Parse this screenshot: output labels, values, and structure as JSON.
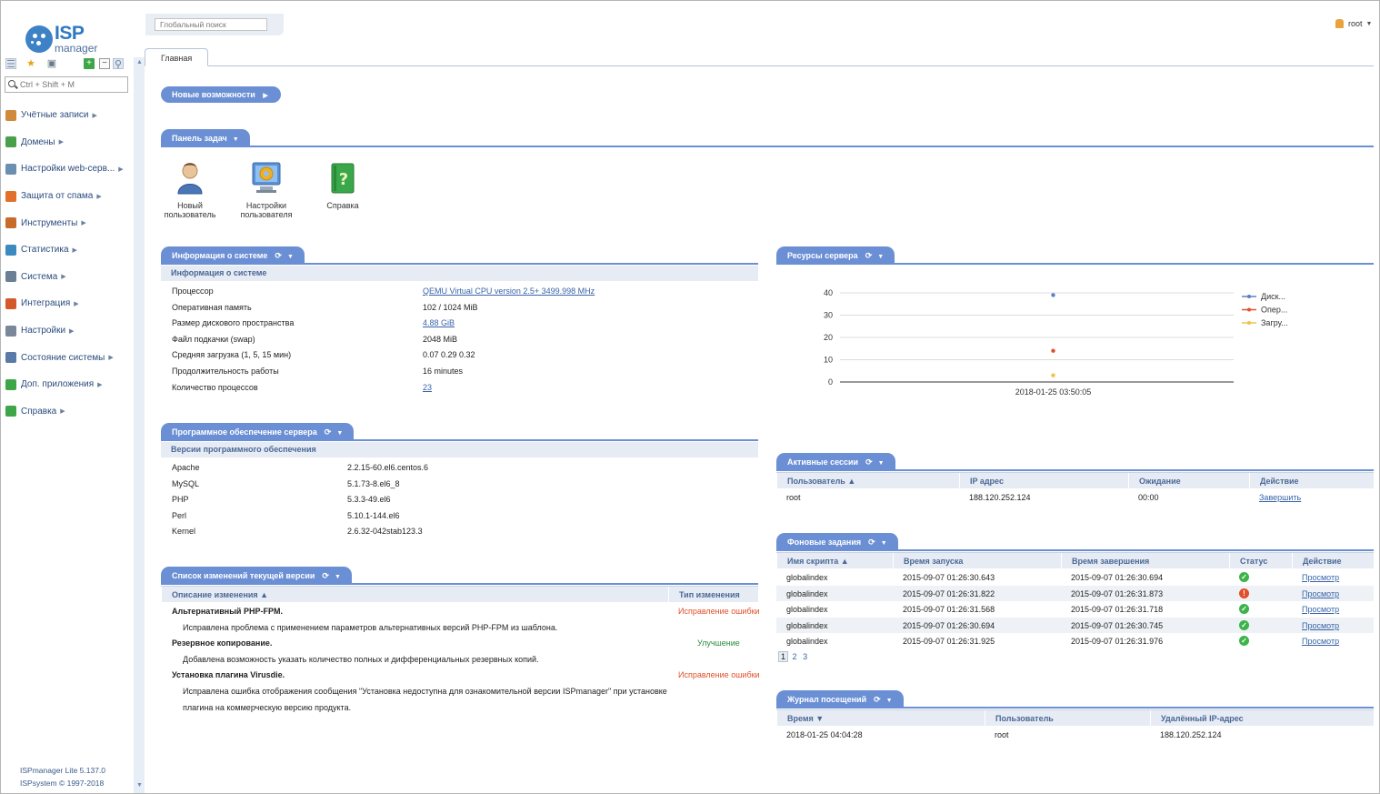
{
  "sidebar": {
    "logo_isp": "ISP",
    "logo_manager": "manager",
    "search_placeholder": "Ctrl + Shift + M",
    "items": [
      {
        "label": "Учётные записи",
        "icon": "user-icon",
        "color": "#d08a3a"
      },
      {
        "label": "Домены",
        "icon": "globe-icon",
        "color": "#4aa04a"
      },
      {
        "label": "Настройки web-серв...",
        "icon": "web-settings-icon",
        "color": "#6a8fb0"
      },
      {
        "label": "Защита от спама",
        "icon": "spam-shield-icon",
        "color": "#e2702a"
      },
      {
        "label": "Инструменты",
        "icon": "tools-icon",
        "color": "#c86a2a"
      },
      {
        "label": "Статистика",
        "icon": "stats-globe-icon",
        "color": "#3b8ac0"
      },
      {
        "label": "Система",
        "icon": "system-icon",
        "color": "#6b7f95"
      },
      {
        "label": "Интеграция",
        "icon": "integration-icon",
        "color": "#d4582a"
      },
      {
        "label": "Настройки",
        "icon": "settings-icon",
        "color": "#7a8699"
      },
      {
        "label": "Состояние системы",
        "icon": "monitor-icon",
        "color": "#5a7aa8"
      },
      {
        "label": "Доп. приложения",
        "icon": "plus-icon",
        "color": "#3ea648"
      },
      {
        "label": "Справка",
        "icon": "help-icon",
        "color": "#3ea648"
      }
    ],
    "version_line1": "ISPmanager Lite 5.137.0",
    "version_line2": "ISPsystem © 1997-2018"
  },
  "header": {
    "global_search_placeholder": "Глобальный поиск",
    "username": "root",
    "tab_main": "Главная"
  },
  "whats_new": {
    "label": "Новые возможности"
  },
  "taskbar": {
    "label": "Панель задач",
    "items": [
      {
        "line1": "Новый",
        "line2": "пользователь",
        "icon": "new-user-icon"
      },
      {
        "line1": "Настройки",
        "line2": "пользователя",
        "icon": "user-settings-icon"
      },
      {
        "line1": "Справка",
        "line2": "",
        "icon": "help-book-icon"
      }
    ]
  },
  "sysinfo": {
    "label": "Информация о системе",
    "sub": "Информация о системе",
    "rows": [
      {
        "k": "Процессор",
        "v": "QEMU Virtual CPU version 2.5+ 3499.998 MHz",
        "link": true
      },
      {
        "k": "Оперативная память",
        "v": "102 / 1024 MiB",
        "link": false
      },
      {
        "k": "Размер дискового пространства",
        "v": "4.88 GiB",
        "link": true
      },
      {
        "k": "Файл подкачки (swap)",
        "v": "2048 MiB",
        "link": false
      },
      {
        "k": "Средняя загрузка (1, 5, 15 мин)",
        "v": "0.07 0.29 0.32",
        "link": false
      },
      {
        "k": "Продолжительность работы",
        "v": "16 minutes",
        "link": false
      },
      {
        "k": "Количество процессов",
        "v": "23",
        "link": true
      }
    ]
  },
  "software": {
    "label": "Программное обеспечение сервера",
    "sub": "Версии программного обеспечения",
    "rows": [
      {
        "k": "Apache",
        "v": "2.2.15-60.el6.centos.6"
      },
      {
        "k": "MySQL",
        "v": "5.1.73-8.el6_8"
      },
      {
        "k": "PHP",
        "v": "5.3.3-49.el6"
      },
      {
        "k": "Perl",
        "v": "5.10.1-144.el6"
      },
      {
        "k": "Kernel",
        "v": "2.6.32-042stab123.3"
      }
    ]
  },
  "changelog": {
    "label": "Список изменений текущей версии",
    "col_desc": "Описание изменения ▲",
    "col_type": "Тип изменения",
    "entries": [
      {
        "title": "Альтернативный PHP-FPM.",
        "type": "Исправление ошибки",
        "kind": "fix",
        "desc1": "Исправлена проблема с применением параметров альтернативных версий PHP-FPM из шаблона.",
        "desc2": ""
      },
      {
        "title": "Резервное копирование.",
        "type": "Улучшение",
        "kind": "improve",
        "desc1": "Добавлена возможность указать количество полных и дифференциальных резервных копий.",
        "desc2": ""
      },
      {
        "title": "Установка плагина Virusdie.",
        "type": "Исправление ошибки",
        "kind": "fix",
        "desc1": "Исправлена ошибка отображения сообщения \"Установка недоступна для ознакомительной версии ISPmanager\" при установке",
        "desc2": "плагина на коммерческую версию продукта."
      }
    ]
  },
  "resources": {
    "label": "Ресурсы сервера",
    "legend": [
      {
        "name": "Диск...",
        "color": "#5b7fc6"
      },
      {
        "name": "Опер...",
        "color": "#e0502a"
      },
      {
        "name": "Загру...",
        "color": "#f0c24a"
      }
    ]
  },
  "chart_data": {
    "type": "line",
    "x": [
      "2018-01-25 03:50:05"
    ],
    "series": [
      {
        "name": "Диск...",
        "values": [
          39
        ],
        "color": "#5b7fc6"
      },
      {
        "name": "Опер...",
        "values": [
          14
        ],
        "color": "#e0502a"
      },
      {
        "name": "Загру...",
        "values": [
          3
        ],
        "color": "#f0c24a"
      }
    ],
    "yticks": [
      "40",
      "30",
      "20",
      "10",
      "0"
    ],
    "ylim": [
      0,
      40
    ],
    "legend_position": "right",
    "grid": true
  },
  "sessions": {
    "label": "Активные сессии",
    "cols": [
      "Пользователь ▲",
      "IP адрес",
      "Ожидание",
      "Действие"
    ],
    "rows": [
      {
        "user": "root",
        "ip": "188.120.252.124",
        "wait": "00:00",
        "action": "Завершить"
      }
    ]
  },
  "jobs": {
    "label": "Фоновые задания",
    "cols": [
      "Имя скрипта ▲",
      "Время запуска",
      "Время завершения",
      "Статус",
      "Действие"
    ],
    "rows": [
      {
        "name": "globalindex",
        "start": "2015-09-07 01:26:30.643",
        "end": "2015-09-07 01:26:30.694",
        "status": "ok",
        "action": "Просмотр"
      },
      {
        "name": "globalindex",
        "start": "2015-09-07 01:26:31.822",
        "end": "2015-09-07 01:26:31.873",
        "status": "error",
        "action": "Просмотр"
      },
      {
        "name": "globalindex",
        "start": "2015-09-07 01:26:31.568",
        "end": "2015-09-07 01:26:31.718",
        "status": "ok",
        "action": "Просмотр"
      },
      {
        "name": "globalindex",
        "start": "2015-09-07 01:26:30.694",
        "end": "2015-09-07 01:26:30.745",
        "status": "ok",
        "action": "Просмотр"
      },
      {
        "name": "globalindex",
        "start": "2015-09-07 01:26:31.925",
        "end": "2015-09-07 01:26:31.976",
        "status": "ok",
        "action": "Просмотр"
      }
    ],
    "pages": [
      "1",
      "2",
      "3"
    ]
  },
  "visits": {
    "label": "Журнал посещений",
    "cols": [
      "Время ▼",
      "Пользователь",
      "Удалённый IP-адрес"
    ],
    "rows": [
      {
        "time": "2018-01-25 04:04:28",
        "user": "root",
        "ip": "188.120.252.124"
      }
    ]
  },
  "icons": {
    "refresh": "⟳",
    "dropdown": "▼",
    "arrow_right": "▶",
    "check": "✓",
    "error": "!"
  }
}
